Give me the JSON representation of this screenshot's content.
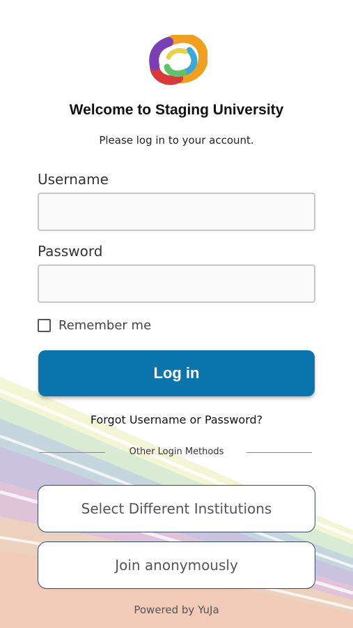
{
  "header": {
    "title": "Welcome to Staging University",
    "subtitle": "Please log in to your account."
  },
  "form": {
    "username_label": "Username",
    "username_value": "",
    "password_label": "Password",
    "password_value": "",
    "remember_label": "Remember me",
    "remember_checked": false,
    "login_button": "Log in",
    "forgot_link": "Forgot Username or Password?"
  },
  "other_methods": {
    "divider_text": "Other Login Methods",
    "buttons": [
      {
        "label": "Select Different Institutions"
      },
      {
        "label": "Join anonymously"
      }
    ]
  },
  "footer": {
    "powered_by": "Powered by YuJa"
  },
  "colors": {
    "primary": "#0b74ad",
    "outline_border": "#344a6b",
    "input_border": "#c7c7c7"
  },
  "icons": {
    "logo": "yuja-swirl-logo",
    "checkbox": "checkbox-unchecked-icon"
  }
}
